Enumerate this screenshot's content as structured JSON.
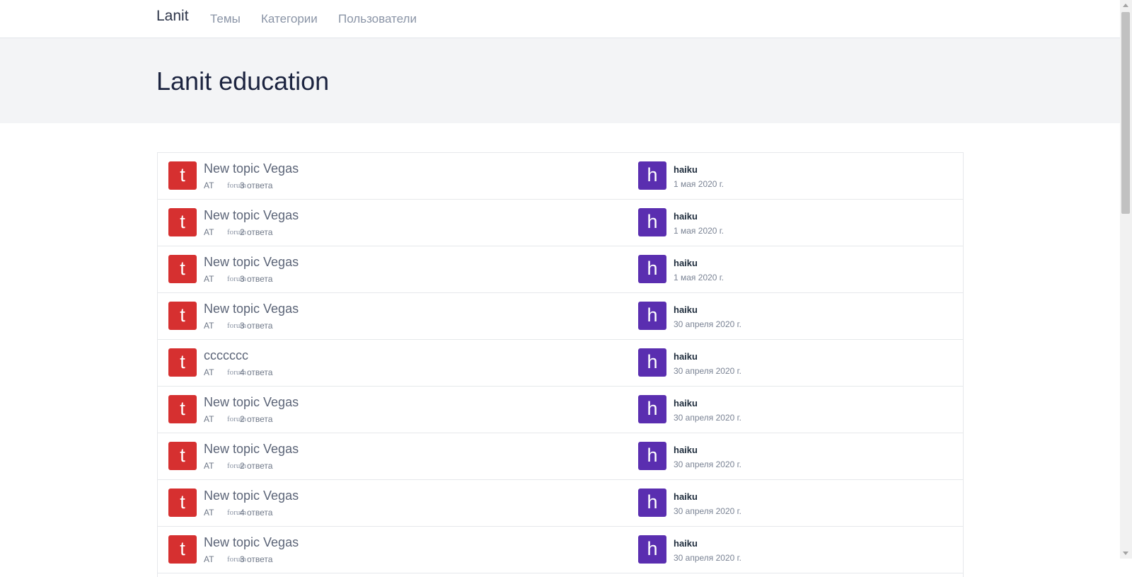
{
  "nav": {
    "brand": "Lanit",
    "links": [
      "Темы",
      "Категории",
      "Пользователи"
    ]
  },
  "hero": {
    "title": "Lanit education"
  },
  "topics": [
    {
      "avatar_letter": "t",
      "title": "New topic Vegas",
      "category": "AT",
      "forum": "forum",
      "replies": "3 ответа",
      "user_avatar_letter": "h",
      "user": "haiku",
      "date": "1 мая 2020 г."
    },
    {
      "avatar_letter": "t",
      "title": "New topic Vegas",
      "category": "AT",
      "forum": "forum",
      "replies": "2 ответа",
      "user_avatar_letter": "h",
      "user": "haiku",
      "date": "1 мая 2020 г."
    },
    {
      "avatar_letter": "t",
      "title": "New topic Vegas",
      "category": "AT",
      "forum": "forum",
      "replies": "3 ответа",
      "user_avatar_letter": "h",
      "user": "haiku",
      "date": "1 мая 2020 г."
    },
    {
      "avatar_letter": "t",
      "title": "New topic Vegas",
      "category": "AT",
      "forum": "forum",
      "replies": "3 ответа",
      "user_avatar_letter": "h",
      "user": "haiku",
      "date": "30 апреля 2020 г."
    },
    {
      "avatar_letter": "t",
      "title": "ccccccc",
      "category": "AT",
      "forum": "forum",
      "replies": "4 ответа",
      "user_avatar_letter": "h",
      "user": "haiku",
      "date": "30 апреля 2020 г."
    },
    {
      "avatar_letter": "t",
      "title": "New topic Vegas",
      "category": "AT",
      "forum": "forum",
      "replies": "2 ответа",
      "user_avatar_letter": "h",
      "user": "haiku",
      "date": "30 апреля 2020 г."
    },
    {
      "avatar_letter": "t",
      "title": "New topic Vegas",
      "category": "AT",
      "forum": "forum",
      "replies": "2 ответа",
      "user_avatar_letter": "h",
      "user": "haiku",
      "date": "30 апреля 2020 г."
    },
    {
      "avatar_letter": "t",
      "title": "New topic Vegas",
      "category": "AT",
      "forum": "forum",
      "replies": "4 ответа",
      "user_avatar_letter": "h",
      "user": "haiku",
      "date": "30 апреля 2020 г."
    },
    {
      "avatar_letter": "t",
      "title": "New topic Vegas",
      "category": "AT",
      "forum": "forum",
      "replies": "3 ответа",
      "user_avatar_letter": "h",
      "user": "haiku",
      "date": "30 апреля 2020 г."
    }
  ]
}
